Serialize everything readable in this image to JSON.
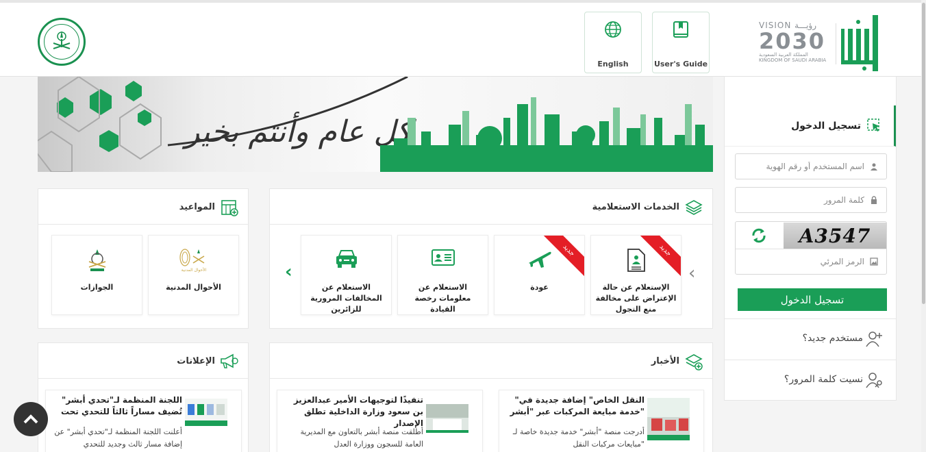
{
  "header": {
    "english_label": "English",
    "guide_label": "User's Guide",
    "vision_top": "VISION رؤيـــة",
    "vision_year": "2030",
    "vision_ar": "المملكة العربية السعودية",
    "vision_en": "KINGDOM OF SAUDI ARABIA"
  },
  "login": {
    "title": "تسجيل الدخول",
    "username_placeholder": "اسم المستخدم أو رقم الهوية",
    "password_placeholder": "كلمة المرور",
    "captcha_text": "A3547",
    "captcha_placeholder": "الرمز المرئي",
    "submit_label": "تسجيل الدخول",
    "new_user": "مستخدم جديد؟",
    "forgot_password": "نسيت كلمة المرور؟"
  },
  "inquiry": {
    "title": "الخدمات الاستعلامية",
    "new_badge": "جديد",
    "tiles": [
      {
        "label": "الإستعلام عن حالة الإعتراض على مخالفة منع التجول",
        "icon": "document-person-icon",
        "is_new": true
      },
      {
        "label": "عودة",
        "icon": "airplane-icon",
        "is_new": true
      },
      {
        "label": "الاستعلام عن معلومات رخصة القيادة",
        "icon": "id-card-icon",
        "is_new": false
      },
      {
        "label": "الاستعلام عن المخالفات المرورية للزائرين",
        "icon": "car-icon",
        "is_new": false
      }
    ]
  },
  "appointments": {
    "title": "المواعيد",
    "tiles": [
      {
        "label": "الأحوال المدنية",
        "logo_text": "الأحوال المدنية"
      },
      {
        "label": "الجوازات"
      }
    ]
  },
  "news": {
    "title": "الأخبار",
    "items": [
      {
        "title": "\"النقل الخاص\" إضافة جديدة في خدمة مبايعة المركبات عبر \"أبشر\"",
        "desc": "أدرجت منصة \"أبشر\" خدمة جديدة خاصة لـ \"مبايعات مركبات النقل"
      },
      {
        "title": "تنفيذًا لتوجيهات الأمير عبدالعزيز بن سعود وزارة الداخلية تطلق الإصدار",
        "desc": "أطلقت منصة أبشر بالتعاون مع المديرية العامة للسجون ووزارة العدل"
      }
    ]
  },
  "announcements": {
    "title": "الإعلانات",
    "items": [
      {
        "title": "اللجنة المنظمة لـ\"تحدي أبشر\" تُضيف مساراً ثالثاً للتحدي تحت",
        "desc": "أعلنت اللجنة المنظمة لـ\"تحدي أبشر\" عن إضافة مسار ثالث وجديد للتحدي"
      }
    ]
  },
  "banner": {
    "greeting": "كل عام وأنتم بخير"
  },
  "colors": {
    "brand_green": "#1a9e57",
    "ribbon_red": "#e41e26"
  }
}
